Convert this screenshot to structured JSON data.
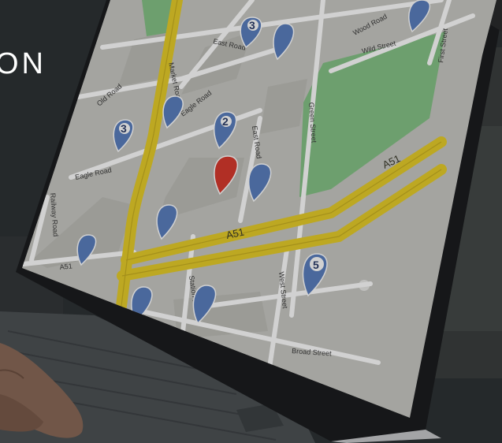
{
  "heading": {
    "fragment": "ON"
  },
  "map": {
    "road_labels": {
      "market_road": "Market Road",
      "east_road_top": "East Road",
      "wood_road": "Wood Road",
      "wild_street": "Wild Street",
      "first_street": "First Street",
      "old_road": "Old Road",
      "eagle_road_upper": "Eagle Road",
      "eagle_road_lower": "Eagle Road",
      "east_road": "East Road",
      "green_street": "Green Street",
      "railway_road": "Railway Road",
      "a51_right": "A51",
      "a51_center": "A51",
      "a51_left": "A51",
      "station_road": "Station Road",
      "west_street": "West Street",
      "broad_street": "Broad Street"
    },
    "pin_numbers": {
      "pin_3a": "3",
      "pin_2": "2",
      "pin_3b": "3",
      "pin_5": "5"
    },
    "colors": {
      "map_bg": "#c9c9c4",
      "park": "#86c287",
      "highway": "#e7cd2a",
      "pin_blue": "#5b7fbf",
      "pin_red": "#d83a2e"
    }
  }
}
